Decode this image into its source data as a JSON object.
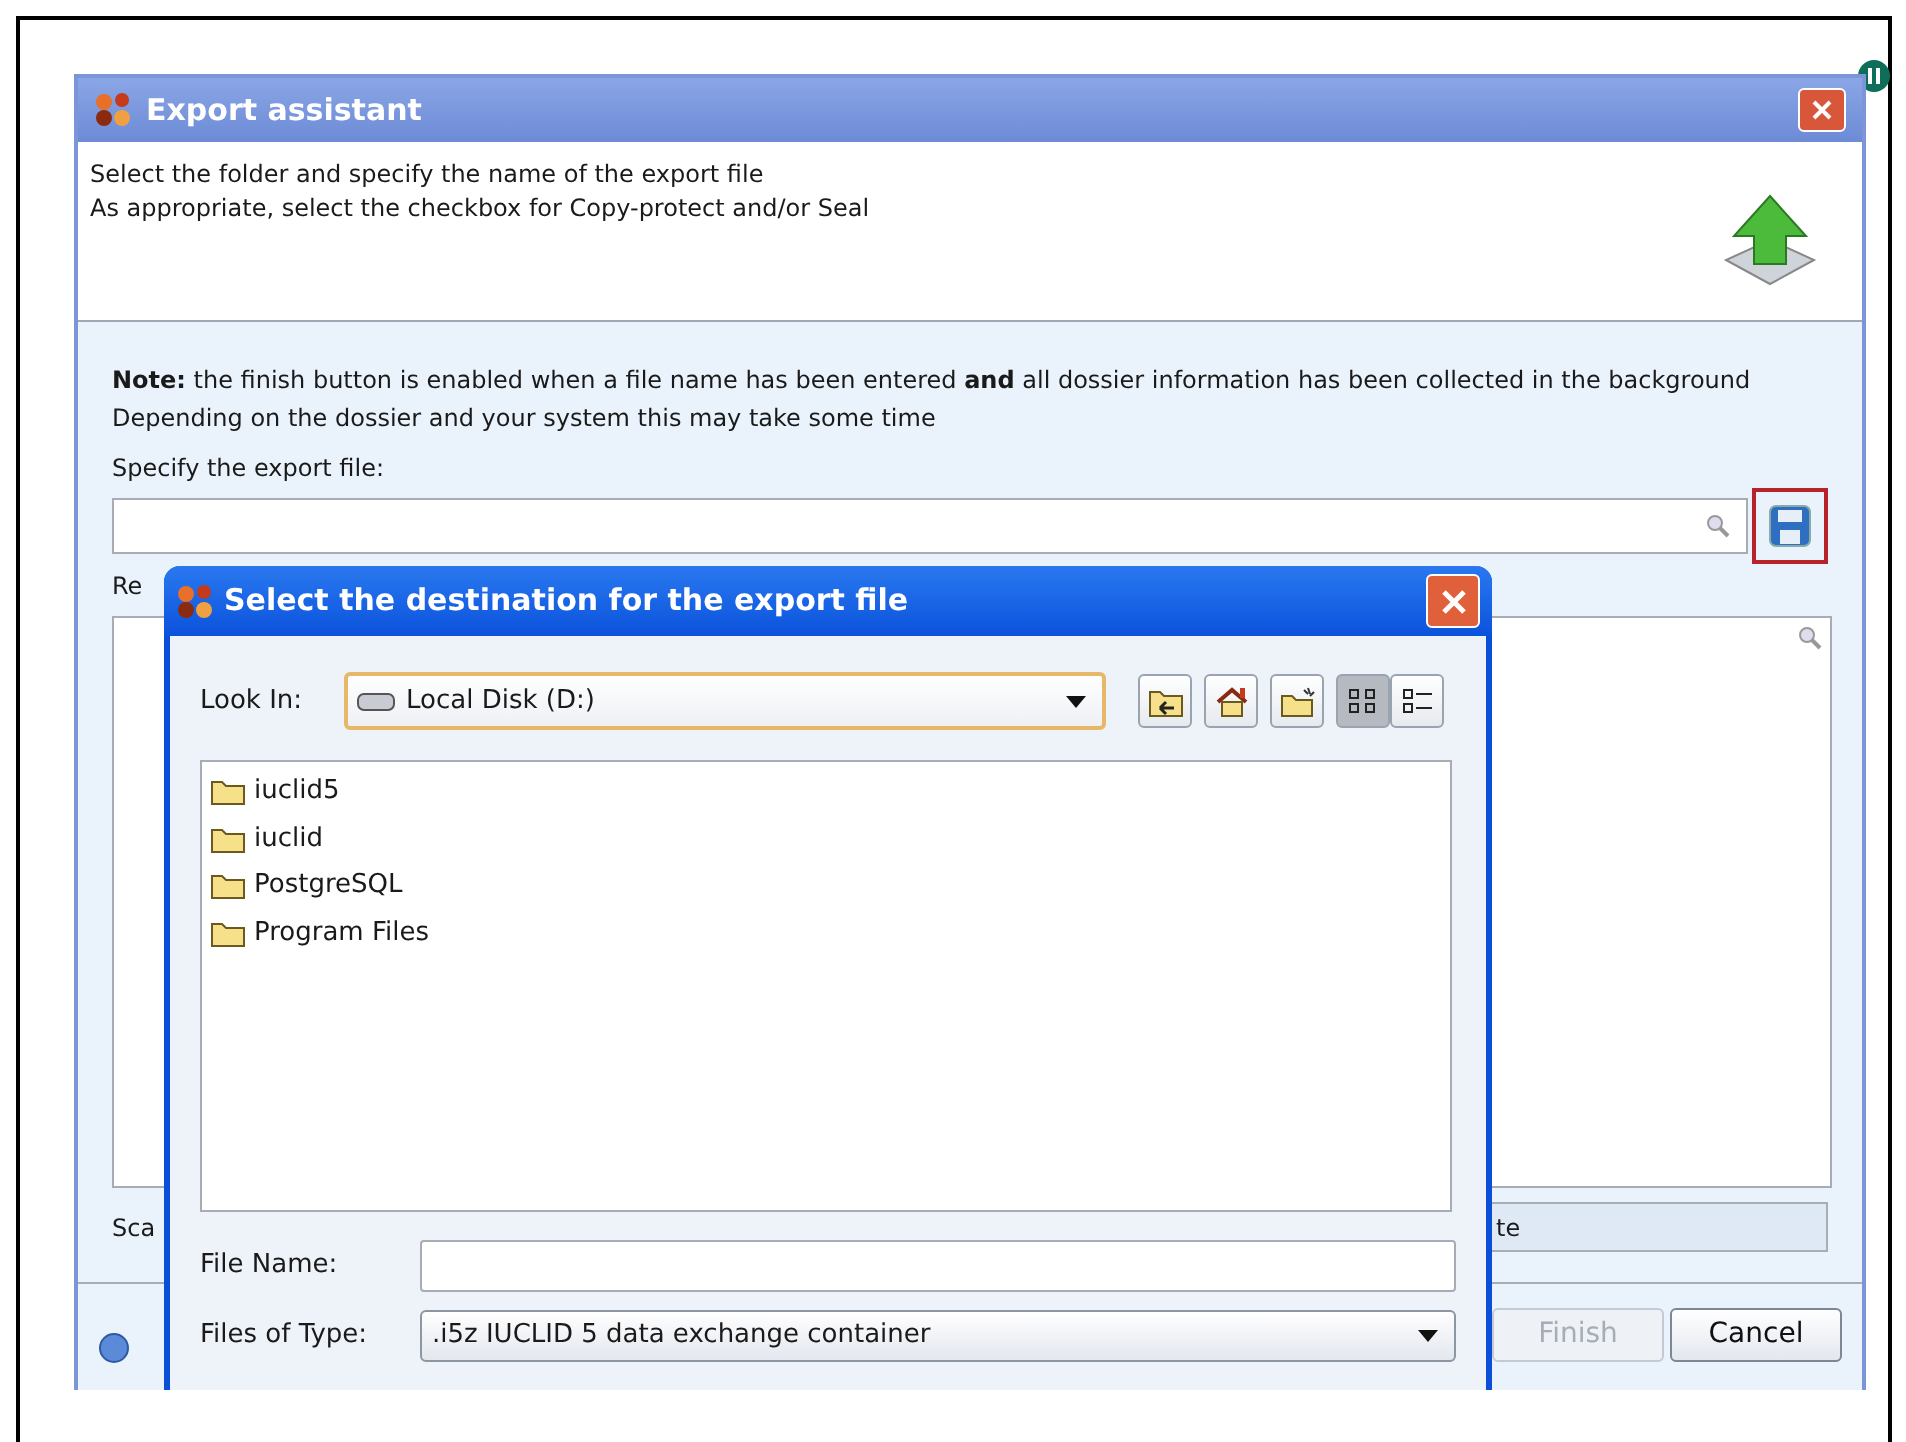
{
  "main_window": {
    "title": "Export assistant",
    "instructions": [
      "Select the folder and specify the name of the export file",
      "As appropriate, select the checkbox for Copy-protect and/or Seal"
    ],
    "note": "**Note:** the finish button is enabled when a file name has been entered **and** all dossier information has been collected in the background",
    "note_detail": "Depending on the dossier and your system this may take some time",
    "export_file_label": "Specify the export file:",
    "remarks_label": "Re",
    "scan_label": "Sca",
    "scan_value": "te",
    "buttons": [
      {
        "label": "Finish",
        "disabled": true
      },
      {
        "label": "Cancel",
        "disabled": false
      }
    ]
  },
  "file_dialog": {
    "title": "Select the destination for the export file",
    "look_in_label": "Look In:",
    "look_in_value": "Local Disk (D:)",
    "toolbar": [
      {
        "kind": "up",
        "selected": false
      },
      {
        "kind": "home",
        "selected": false
      },
      {
        "kind": "new_folder",
        "selected": false
      },
      {
        "kind": "list",
        "selected": true
      },
      {
        "kind": "details",
        "selected": false
      }
    ],
    "files": [
      "iuclid5",
      "iuclid",
      "PostgreSQL",
      "Program Files"
    ],
    "file_name_label": "File Name:",
    "file_type_label": "Files of Type:",
    "file_type_value": ".i5z IUCLID 5 data exchange container"
  }
}
